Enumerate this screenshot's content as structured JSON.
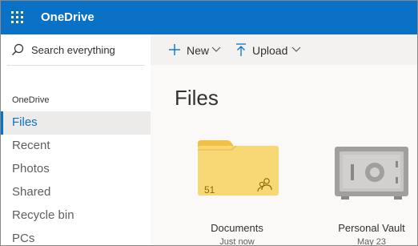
{
  "app": {
    "title": "OneDrive"
  },
  "search": {
    "placeholder": "Search everything"
  },
  "commands": {
    "new_label": "New",
    "upload_label": "Upload"
  },
  "sidebar": {
    "header": "OneDrive",
    "items": [
      {
        "label": "Files",
        "active": true
      },
      {
        "label": "Recent"
      },
      {
        "label": "Photos"
      },
      {
        "label": "Shared"
      },
      {
        "label": "Recycle bin"
      },
      {
        "label": "PCs"
      }
    ]
  },
  "main": {
    "title": "Files",
    "tiles": [
      {
        "name": "Documents",
        "modified": "Just now",
        "item_count": "51",
        "icon": "folder-shared-icon"
      },
      {
        "name": "Personal Vault",
        "modified": "May 23",
        "icon": "vault-safe-icon"
      }
    ]
  },
  "colors": {
    "accent": "#0a72c6",
    "folder": "#f8d775",
    "folder_tab": "#f2c142",
    "vault": "#a19f9d"
  }
}
